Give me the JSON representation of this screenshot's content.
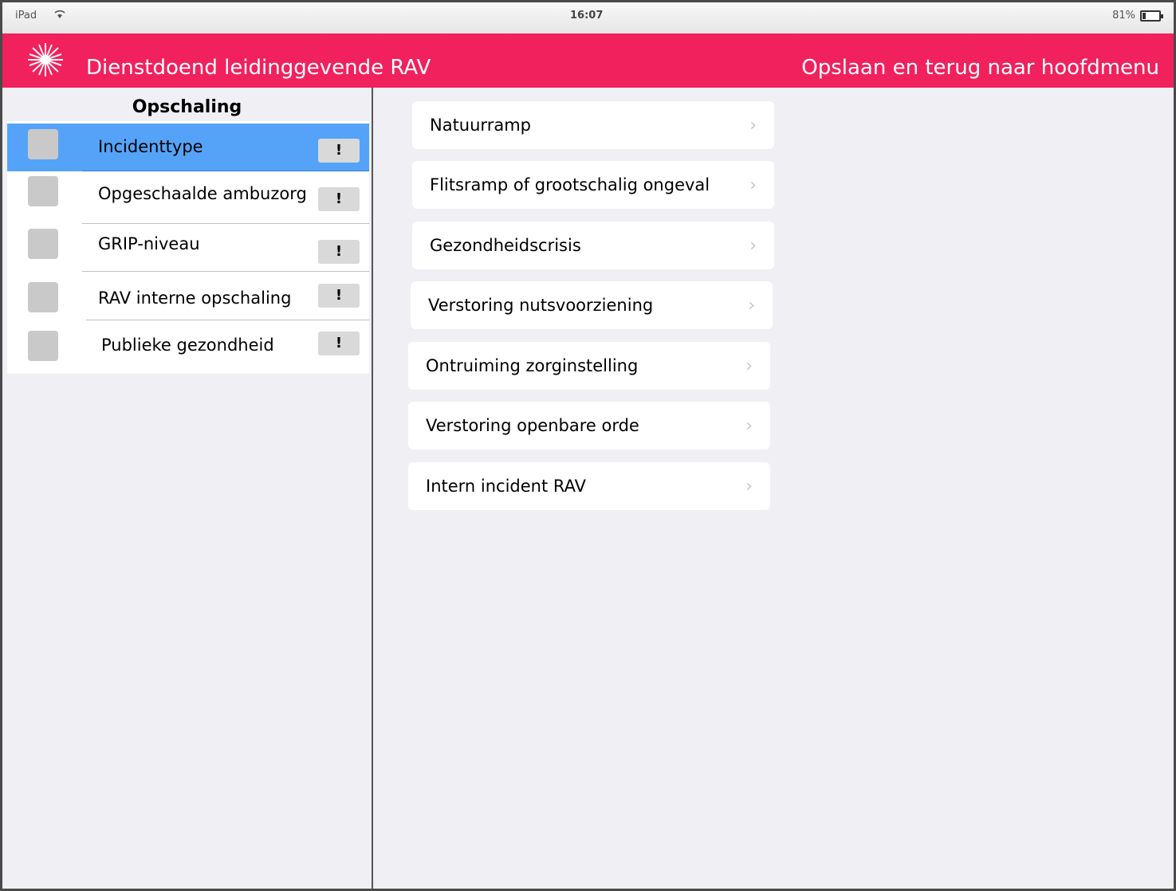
{
  "statusbar": {
    "device": "iPad",
    "clock": "16:07",
    "battery_pct": "81%"
  },
  "header": {
    "title": "Dienstdoend leidinggevende RAV",
    "save_link": "Opslaan en terug naar hoofdmenu",
    "bg_color": "#f0215c"
  },
  "left_panel": {
    "heading": "Opschaling",
    "items": [
      {
        "label": "Incidenttype",
        "alert": "!",
        "selected": true
      },
      {
        "label": "Opgeschaalde ambuzorg",
        "alert": "!",
        "selected": false
      },
      {
        "label": "GRIP-niveau",
        "alert": "!",
        "selected": false
      },
      {
        "label": "RAV interne opschaling",
        "alert": "!",
        "selected": false
      },
      {
        "label": "Publieke gezondheid",
        "alert": "!",
        "selected": false
      }
    ],
    "selected_color": "#55a3f8"
  },
  "incident_types": [
    {
      "label": "Natuurramp"
    },
    {
      "label": "Flitsramp of grootschalig ongeval"
    },
    {
      "label": "Gezondheidscrisis"
    },
    {
      "label": "Verstoring nutsvoorziening"
    },
    {
      "label": "Ontruiming zorginstelling"
    },
    {
      "label": "Verstoring openbare orde"
    },
    {
      "label": "Intern incident RAV"
    }
  ],
  "icons": {
    "chevron": "chevron-right-icon",
    "logo": "logo-icon",
    "wifi": "wifi-icon",
    "battery": "battery-icon"
  }
}
